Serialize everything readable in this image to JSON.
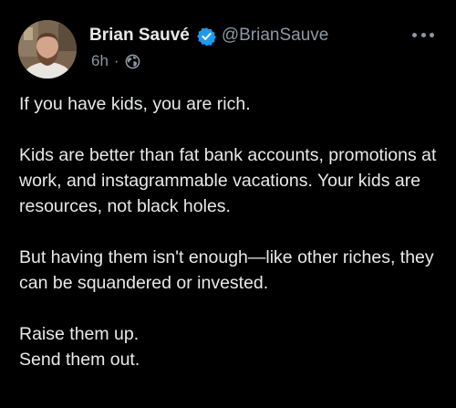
{
  "author": {
    "name": "Brian Sauvé",
    "handle": "@BrianSauve",
    "verified_icon": "verified-badge-icon",
    "avatar": "profile-photo"
  },
  "meta": {
    "time": "6h",
    "separator": "·",
    "audience_icon": "globe-icon"
  },
  "more_icon": "more-options-icon",
  "colors": {
    "background": "#000000",
    "text": "#e7e9ea",
    "muted": "#8b98a5",
    "verified": "#1d9bf0"
  },
  "body": {
    "para1": "If you have kids, you are rich.",
    "para2": "Kids are better than fat bank accounts, promotions at work, and instagrammable vacations. Your kids are resources, not black holes.",
    "para3": "But having them isn't enough—like other riches, they can be squandered or invested.",
    "para4_line1": "Raise them up.",
    "para4_line2": "Send them out."
  }
}
